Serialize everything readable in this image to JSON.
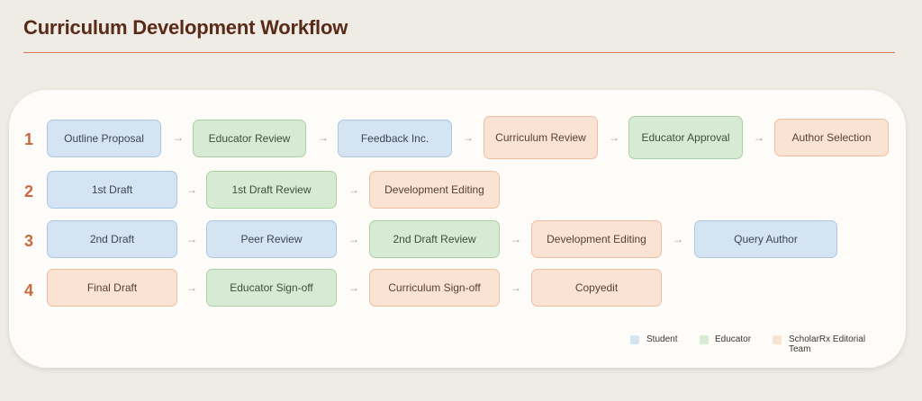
{
  "title": "Curriculum Development Workflow",
  "rows": [
    {
      "number": "1",
      "steps": [
        {
          "label": "Outline Proposal",
          "role": "student"
        },
        {
          "label": "Educator Review",
          "role": "educator"
        },
        {
          "label": "Feedback Inc.",
          "role": "student"
        },
        {
          "label": "Curriculum Review",
          "role": "editorial"
        },
        {
          "label": "Educator Approval",
          "role": "educator"
        },
        {
          "label": "Author Selection",
          "role": "editorial"
        }
      ]
    },
    {
      "number": "2",
      "steps": [
        {
          "label": "1st Draft",
          "role": "student"
        },
        {
          "label": "1st Draft Review",
          "role": "educator"
        },
        {
          "label": "Development Editing",
          "role": "editorial"
        }
      ]
    },
    {
      "number": "3",
      "steps": [
        {
          "label": "2nd Draft",
          "role": "student"
        },
        {
          "label": "Peer Review",
          "role": "student"
        },
        {
          "label": "2nd Draft Review",
          "role": "educator"
        },
        {
          "label": "Development Editing",
          "role": "editorial"
        },
        {
          "label": "Query Author",
          "role": "student"
        }
      ]
    },
    {
      "number": "4",
      "steps": [
        {
          "label": "Final Draft",
          "role": "editorial"
        },
        {
          "label": "Educator Sign-off",
          "role": "educator"
        },
        {
          "label": "Curriculum Sign-off",
          "role": "editorial"
        },
        {
          "label": "Copyedit",
          "role": "editorial"
        }
      ]
    }
  ],
  "arrow_glyph": "→",
  "legend": [
    {
      "label": "Student",
      "role": "student"
    },
    {
      "label": "Educator",
      "role": "educator"
    },
    {
      "label": "ScholarRx Editorial Team",
      "role": "editorial"
    }
  ],
  "colors": {
    "student": "#d4e4f3",
    "educator": "#d7ebd4",
    "editorial": "#fbe3d4",
    "title": "#5a2a18",
    "accent": "#c8693e"
  }
}
